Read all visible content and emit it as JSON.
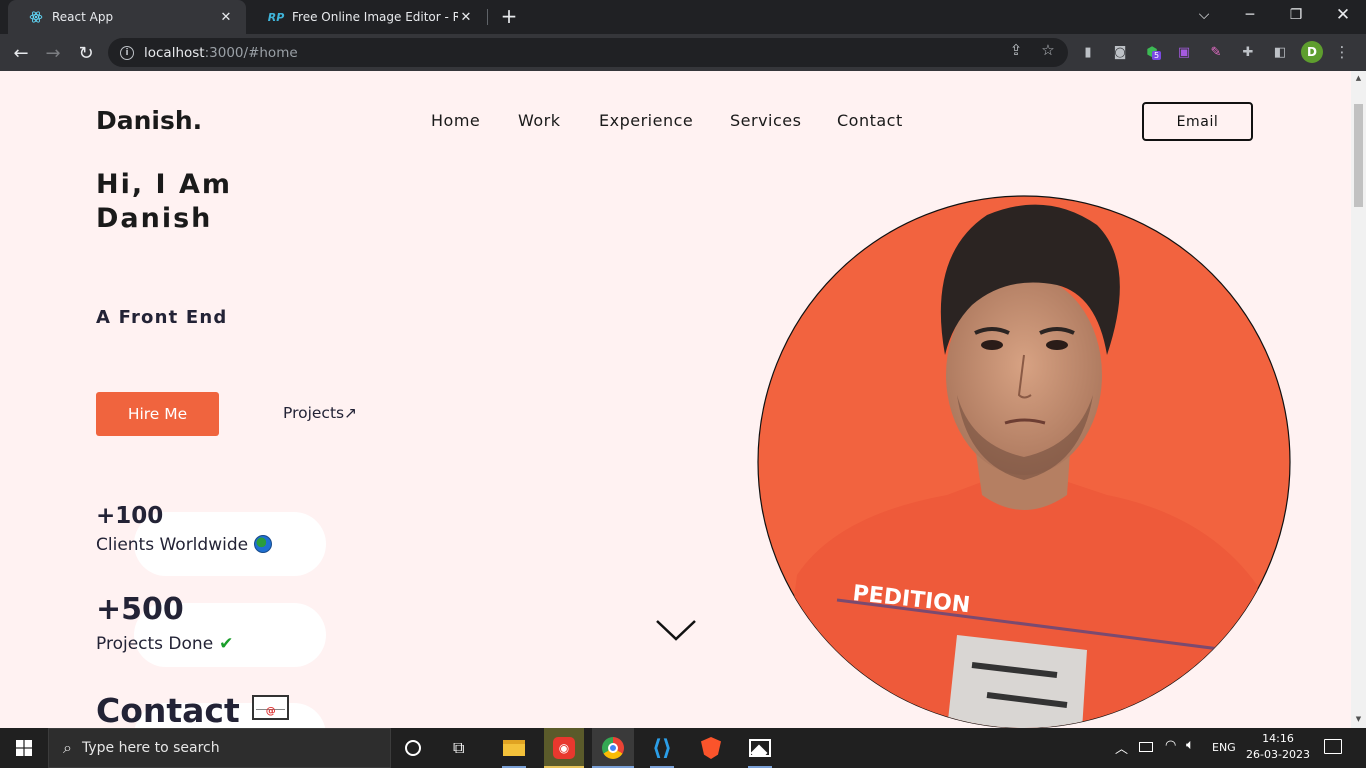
{
  "browser": {
    "tabs": [
      {
        "title": "React App",
        "active": true
      },
      {
        "title": "Free Online Image Editor - Resize",
        "active": false
      }
    ],
    "address": {
      "host": "localhost",
      "rest": ":3000/#home"
    }
  },
  "site": {
    "logo": "Danish.",
    "nav": [
      "Home",
      "Work",
      "Experience",
      "Services",
      "Contact"
    ],
    "email_button": "Email",
    "hero": {
      "title_line1": "Hi, I Am",
      "title_line2": "Danish",
      "subtitle": "A Front End",
      "hire_button": "Hire Me",
      "projects_link": "Projects",
      "projects_arrow": "↗"
    },
    "stats": [
      {
        "value": "+100",
        "label": "Clients Worldwide"
      },
      {
        "value": "+500",
        "label": "Projects Done"
      }
    ],
    "contact_heading": "Contact",
    "portrait_caption_shirt": "PEDITION",
    "accent_color": "#f0643e",
    "bg_color": "#fff2f2"
  },
  "taskbar": {
    "search_placeholder": "Type here to search",
    "language": "ENG",
    "time": "14:16",
    "date": "26-03-2023"
  },
  "extensions": {
    "badge": "5"
  },
  "profile_initial": "D"
}
